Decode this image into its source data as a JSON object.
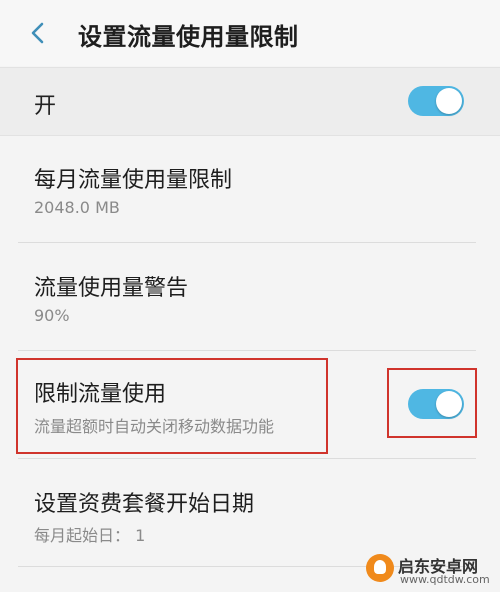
{
  "header": {
    "back_icon": "chevron-left-icon",
    "title": "设置流量使用量限制"
  },
  "master_switch": {
    "label": "开",
    "on": true
  },
  "items": [
    {
      "title": "每月流量使用量限制",
      "subtitle": "2048.0 MB"
    },
    {
      "title": "流量使用量警告",
      "subtitle": "90%"
    },
    {
      "title": "限制流量使用",
      "subtitle": "流量超额时自动关闭移动数据功能",
      "toggle_on": true
    },
    {
      "title": "设置资费套餐开始日期",
      "subtitle": "每月起始日： 1"
    }
  ],
  "colors": {
    "toggle_on": "#4fb7e3",
    "highlight": "#d0342c"
  },
  "watermark": {
    "name": "启东安卓网",
    "url": "www.qdtdw.com"
  }
}
